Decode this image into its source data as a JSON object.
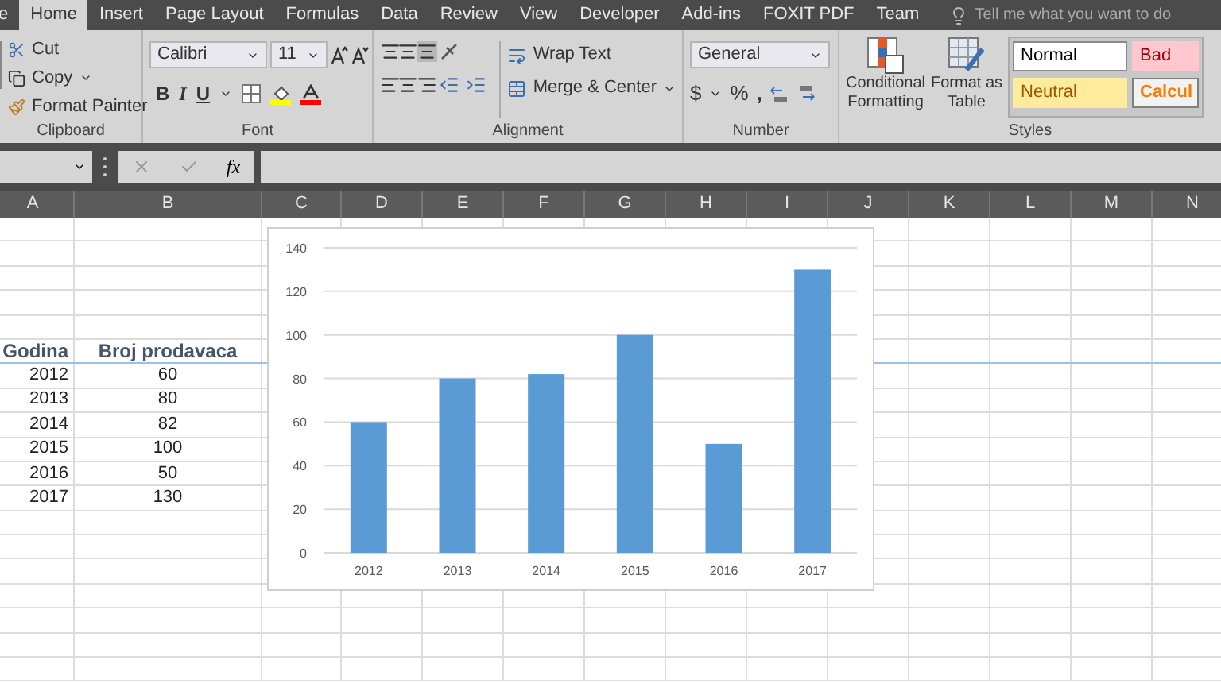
{
  "tabs": [
    {
      "label": "e",
      "selected": false
    },
    {
      "label": "Home",
      "selected": true
    },
    {
      "label": "Insert",
      "selected": false
    },
    {
      "label": "Page Layout",
      "selected": false
    },
    {
      "label": "Formulas",
      "selected": false
    },
    {
      "label": "Data",
      "selected": false
    },
    {
      "label": "Review",
      "selected": false
    },
    {
      "label": "View",
      "selected": false
    },
    {
      "label": "Developer",
      "selected": false
    },
    {
      "label": "Add-ins",
      "selected": false
    },
    {
      "label": "FOXIT PDF",
      "selected": false
    },
    {
      "label": "Team",
      "selected": false
    }
  ],
  "tell_me": {
    "placeholder": "Tell me what you want to do"
  },
  "clipboard": {
    "label": "Clipboard",
    "cut": "Cut",
    "copy": "Copy",
    "format_painter": "Format Painter"
  },
  "font": {
    "label": "Font",
    "family": "Calibri",
    "size": "11",
    "bold": "B",
    "italic": "I",
    "underline": "U"
  },
  "alignment": {
    "label": "Alignment",
    "wrap_text": "Wrap Text",
    "merge_center": "Merge & Center"
  },
  "number": {
    "label": "Number",
    "format": "General",
    "currency": "$",
    "percent": "%",
    "comma": ","
  },
  "styles": {
    "label": "Styles",
    "conditional_formatting": [
      "Conditional",
      "Formatting"
    ],
    "format_as_table": [
      "Format as",
      "Table"
    ],
    "cells": [
      {
        "label": "Normal",
        "kind": "normal"
      },
      {
        "label": "Bad",
        "kind": "bad"
      },
      {
        "label": "Neutral",
        "kind": "neutral"
      },
      {
        "label": "Calcul",
        "kind": "calculation"
      }
    ]
  },
  "formula_bar": {
    "fx": "fx"
  },
  "columns": [
    "A",
    "B",
    "C",
    "D",
    "E",
    "F",
    "G",
    "H",
    "I",
    "J",
    "K",
    "L",
    "M",
    "N"
  ],
  "table": {
    "header": [
      "Godina",
      "Broj prodavaca"
    ],
    "rows": [
      [
        "2012",
        "60"
      ],
      [
        "2013",
        "80"
      ],
      [
        "2014",
        "82"
      ],
      [
        "2015",
        "100"
      ],
      [
        "2016",
        "50"
      ],
      [
        "2017",
        "130"
      ]
    ]
  },
  "chart_data": {
    "type": "bar",
    "categories": [
      "2012",
      "2013",
      "2014",
      "2015",
      "2016",
      "2017"
    ],
    "series": [
      {
        "color": "#5b9bd5",
        "values": [
          60,
          80,
          82,
          100,
          50,
          130
        ]
      }
    ],
    "grid": true,
    "ylim": [
      0,
      140
    ],
    "yticks": [
      0,
      20,
      40,
      60,
      80,
      100,
      120,
      140
    ]
  }
}
